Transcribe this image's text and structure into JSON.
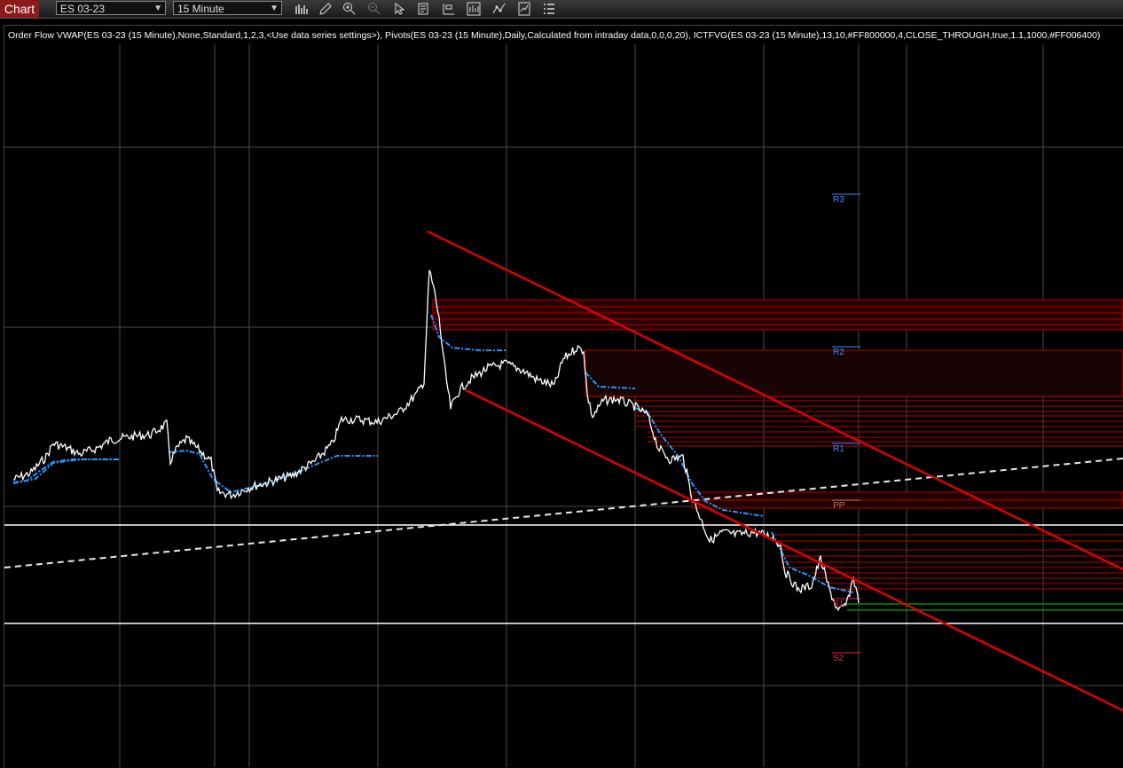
{
  "toolbar": {
    "tab_label": "Chart",
    "instrument": "ES 03-23",
    "interval": "15 Minute",
    "tools": [
      "bar-chart-icon",
      "pencil-icon",
      "zoom-in-icon",
      "zoom-out-icon",
      "pointer-icon",
      "data-box-icon",
      "drawing-tools-icon",
      "chart-style-icon",
      "indicators-icon",
      "strategies-icon",
      "properties-icon"
    ]
  },
  "indicator_text": "Order Flow VWAP(ES 03-23 (15 Minute),None,Standard,1,2,3,<Use data series settings>), Pivots(ES 03-23 (15 Minute),Daily,Calculated from intraday data,0,0,0,20), ICTFVG(ES 03-23 (15 Minute),13,10,#FF800000,4,CLOSE_THROUGH,true,1.1,1000,#FF006400)",
  "pivots": {
    "r3": "R3",
    "r2": "R2",
    "r1": "R1",
    "pp": "PP",
    "s1": "S1",
    "s2": "S2"
  },
  "colors": {
    "background": "#000000",
    "price": "#ffffff",
    "vwap": "#1e9bff",
    "trendline": "#e00000",
    "fvg_bear": "#8b0000",
    "fvg_bull": "#006400",
    "pivot_r": "#3c8cff",
    "pivot_pp": "#c8783c",
    "pivot_s": "#e0284a"
  }
}
